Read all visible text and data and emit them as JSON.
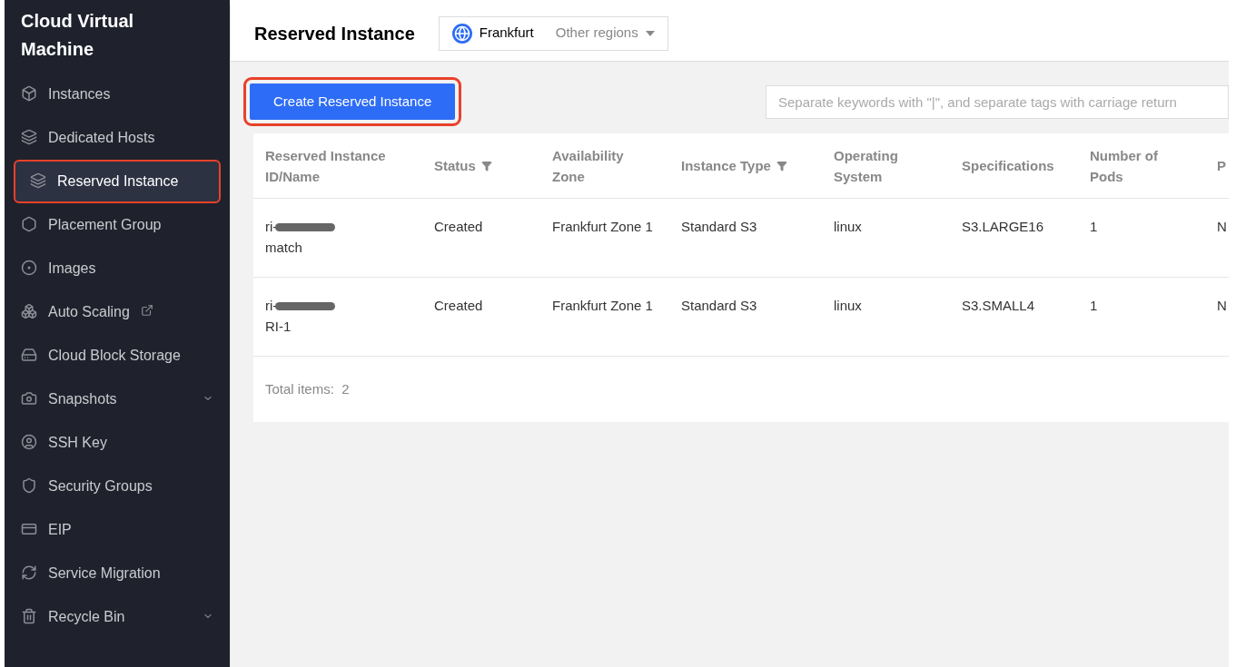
{
  "sidebar": {
    "title": "Cloud Virtual Machine",
    "items": [
      {
        "label": "Instances",
        "selected": false,
        "highlighted": false,
        "external": false,
        "expandable": false
      },
      {
        "label": "Dedicated Hosts",
        "selected": false,
        "highlighted": false,
        "external": false,
        "expandable": false
      },
      {
        "label": "Reserved Instance",
        "selected": true,
        "highlighted": true,
        "external": false,
        "expandable": false
      },
      {
        "label": "Placement Group",
        "selected": false,
        "highlighted": false,
        "external": false,
        "expandable": false
      },
      {
        "label": "Images",
        "selected": false,
        "highlighted": false,
        "external": false,
        "expandable": false
      },
      {
        "label": "Auto Scaling",
        "selected": false,
        "highlighted": false,
        "external": true,
        "expandable": false
      },
      {
        "label": "Cloud Block Storage",
        "selected": false,
        "highlighted": false,
        "external": false,
        "expandable": false
      },
      {
        "label": "Snapshots",
        "selected": false,
        "highlighted": false,
        "external": false,
        "expandable": true
      },
      {
        "label": "SSH Key",
        "selected": false,
        "highlighted": false,
        "external": false,
        "expandable": false
      },
      {
        "label": "Security Groups",
        "selected": false,
        "highlighted": false,
        "external": false,
        "expandable": false
      },
      {
        "label": "EIP",
        "selected": false,
        "highlighted": false,
        "external": false,
        "expandable": false
      },
      {
        "label": "Service Migration",
        "selected": false,
        "highlighted": false,
        "external": false,
        "expandable": false
      },
      {
        "label": "Recycle Bin",
        "selected": false,
        "highlighted": false,
        "external": false,
        "expandable": true
      }
    ]
  },
  "header": {
    "title": "Reserved Instance",
    "region": "Frankfurt",
    "other_regions": "Other regions"
  },
  "toolbar": {
    "create_button": {
      "label": "Create Reserved Instance",
      "highlighted": true
    },
    "search": {
      "placeholder": "Separate keywords with \"|\", and separate tags with carriage return"
    }
  },
  "table": {
    "columns": [
      {
        "label": "Reserved Instance ID/Name",
        "filter": false
      },
      {
        "label": "Status",
        "filter": true
      },
      {
        "label": "Availability Zone",
        "filter": false
      },
      {
        "label": "Instance Type",
        "filter": true
      },
      {
        "label": "Operating System",
        "filter": false
      },
      {
        "label": "Specifications",
        "filter": false
      },
      {
        "label": "Number of Pods",
        "filter": false
      },
      {
        "label": "P",
        "filter": false
      }
    ],
    "rows": [
      {
        "cells": [
          {
            "id": "ri-",
            "redacted": true,
            "name": "match"
          },
          "Created",
          "Frankfurt Zone 1",
          "Standard S3",
          "linux",
          "S3.LARGE16",
          "1",
          "N"
        ]
      },
      {
        "cells": [
          {
            "id": "ri-",
            "redacted": true,
            "name": "RI-1"
          },
          "Created",
          "Frankfurt Zone 1",
          "Standard S3",
          "linux",
          "S3.SMALL4",
          "1",
          "N"
        ]
      }
    ],
    "footer": {
      "label": "Total items:",
      "count": "2"
    }
  }
}
